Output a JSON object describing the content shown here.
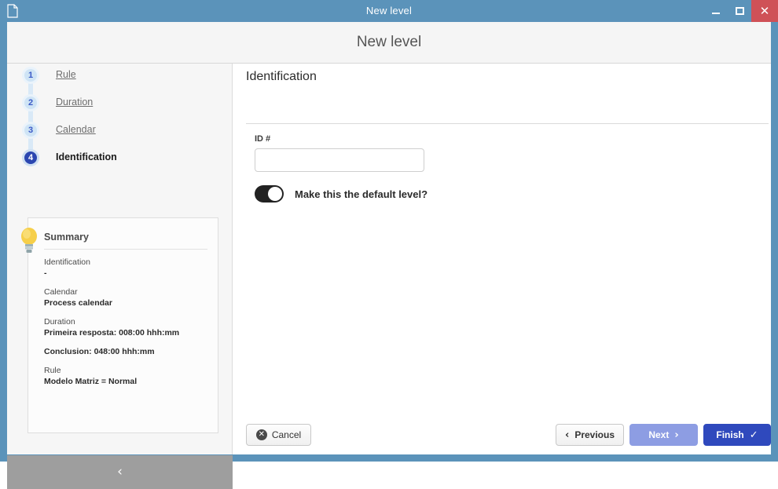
{
  "window": {
    "title": "New level",
    "doc_icon": "document-icon",
    "minimize_label": "–",
    "maximize_label": "❐",
    "close_label": "✕",
    "frame_color": "#5b93ba",
    "close_color": "#cf5157"
  },
  "header": {
    "title": "New level"
  },
  "sidebar": {
    "steps": [
      {
        "number": "1",
        "label": "Rule",
        "active": false
      },
      {
        "number": "2",
        "label": "Duration",
        "active": false
      },
      {
        "number": "3",
        "label": "Calendar",
        "active": false
      },
      {
        "number": "4",
        "label": "Identification",
        "active": true
      }
    ],
    "summary": {
      "icon": "lightbulb-icon",
      "title": "Summary",
      "groups": [
        {
          "label": "Identification",
          "value": "-"
        },
        {
          "label": "Calendar",
          "value": "Process calendar"
        },
        {
          "label": "Duration",
          "value": "Primeira resposta: 008:00 hhh:mm"
        },
        {
          "label": "",
          "value": "Conclusion: 048:00 hhh:mm"
        },
        {
          "label": "Rule",
          "value": "Modelo Matriz = Normal"
        }
      ]
    },
    "collapse": {
      "icon": "chevron-left-icon",
      "glyph": "‹"
    }
  },
  "main": {
    "section_title": "Identification",
    "id_field": {
      "label": "ID #",
      "value": "",
      "placeholder": ""
    },
    "default_toggle": {
      "label": "Make this the default level?",
      "state": "on"
    }
  },
  "footer": {
    "cancel": {
      "label": "Cancel",
      "icon": "circle-x-icon",
      "glyph": "✕"
    },
    "previous": {
      "label": "Previous",
      "icon": "chevron-left-icon",
      "glyph": "‹"
    },
    "next": {
      "label": "Next",
      "icon": "chevron-right-icon",
      "glyph": "›",
      "state": "disabled"
    },
    "finish": {
      "label": "Finish",
      "icon": "check-icon",
      "glyph": "✓"
    }
  }
}
